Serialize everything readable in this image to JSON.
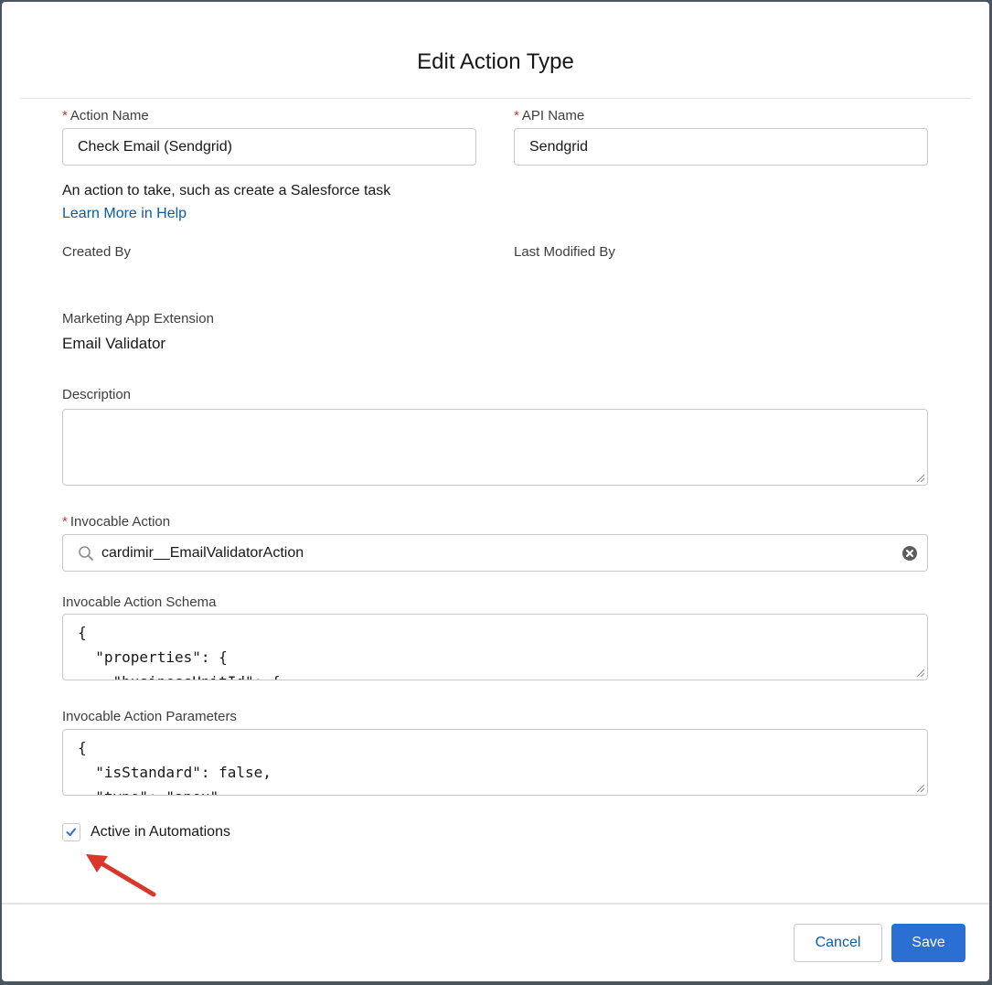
{
  "modal": {
    "title": "Edit Action Type"
  },
  "form": {
    "action_name": {
      "label": "Action Name",
      "required": "*",
      "value": "Check Email (Sendgrid)"
    },
    "api_name": {
      "label": "API Name",
      "required": "*",
      "value": "Sendgrid"
    },
    "help_text": "An action to take, such as create a Salesforce task",
    "help_link": "Learn More in Help",
    "created_by": {
      "label": "Created By"
    },
    "last_modified_by": {
      "label": "Last Modified By"
    },
    "marketing_app_extension": {
      "label": "Marketing App Extension",
      "value": "Email Validator"
    },
    "description": {
      "label": "Description",
      "value": ""
    },
    "invocable_action": {
      "label": "Invocable Action",
      "required": "*",
      "value": "cardimir__EmailValidatorAction"
    },
    "schema": {
      "label": "Invocable Action Schema",
      "value": "{\n  \"properties\": {\n    \"businessUnitId\": {"
    },
    "parameters": {
      "label": "Invocable Action Parameters",
      "value": "{\n  \"isStandard\": false,\n  \"type\": \"apex\","
    },
    "active": {
      "label": "Active in Automations",
      "checked": true
    }
  },
  "footer": {
    "cancel_label": "Cancel",
    "save_label": "Save"
  },
  "colors": {
    "brand": "#2a6fd1",
    "link": "#0b5cab",
    "required": "#c23934",
    "annotation_arrow": "#d9372b"
  },
  "icons": [
    "search-icon",
    "clear-icon",
    "checkmark-icon",
    "resize-handle-icon",
    "annotation-arrow"
  ]
}
